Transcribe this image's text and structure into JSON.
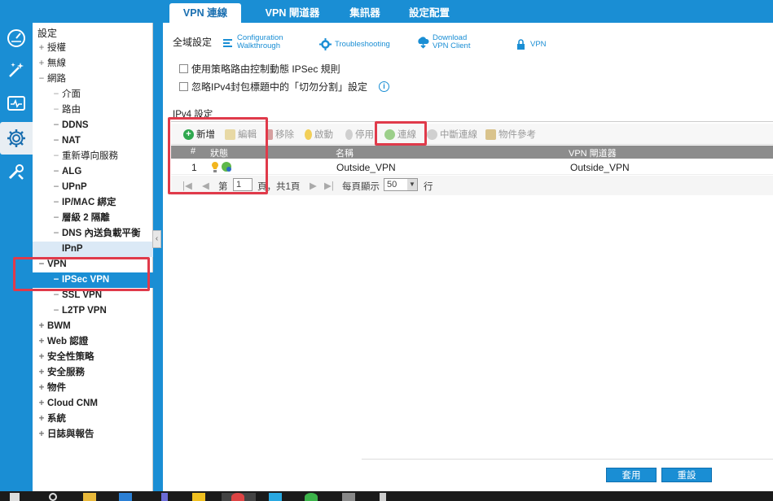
{
  "rail": {
    "items": [
      {
        "icon": "dashboard-icon"
      },
      {
        "icon": "wizard-icon"
      },
      {
        "icon": "monitor-icon"
      },
      {
        "icon": "gear-icon"
      },
      {
        "icon": "maintenance-icon"
      }
    ]
  },
  "tabs": [
    "VPN 連線",
    "VPN 閘道器",
    "集訊器",
    "設定配置"
  ],
  "nav": {
    "title": "設定",
    "items": [
      {
        "label": "授權",
        "pm": "+"
      },
      {
        "label": "無線",
        "pm": "+"
      },
      {
        "label": "網路",
        "pm": "−"
      },
      {
        "label": "介面",
        "pm": "−"
      },
      {
        "label": "路由",
        "pm": "−"
      },
      {
        "label": "DDNS",
        "pm": "−"
      },
      {
        "label": "NAT",
        "pm": "−"
      },
      {
        "label": "重新導向服務",
        "pm": "−"
      },
      {
        "label": "ALG",
        "pm": "−"
      },
      {
        "label": "UPnP",
        "pm": "−"
      },
      {
        "label": "IP/MAC 綁定",
        "pm": "−"
      },
      {
        "label": "層級 2 隔離",
        "pm": "−"
      },
      {
        "label": "DNS 內送負載平衡",
        "pm": "−"
      },
      {
        "label": "IPnP",
        "pm": ""
      },
      {
        "label": "VPN",
        "pm": "−"
      },
      {
        "label": "IPSec VPN",
        "pm": "−"
      },
      {
        "label": "SSL VPN",
        "pm": "−"
      },
      {
        "label": "L2TP VPN",
        "pm": "−"
      },
      {
        "label": "BWM",
        "pm": "+"
      },
      {
        "label": "Web 認證",
        "pm": "+"
      },
      {
        "label": "安全性策略",
        "pm": "+"
      },
      {
        "label": "安全服務",
        "pm": "+"
      },
      {
        "label": "物件",
        "pm": "+"
      },
      {
        "label": "Cloud CNM",
        "pm": "+"
      },
      {
        "label": "系統",
        "pm": "+"
      },
      {
        "label": "日誌與報告",
        "pm": "+"
      }
    ]
  },
  "main": {
    "global_label": "全域設定",
    "top_buttons": [
      {
        "label1": "Configuration",
        "label2": "Walkthrough",
        "icon": "walkthrough-icon"
      },
      {
        "label1": "Troubleshooting",
        "label2": "",
        "icon": "troubleshooting-icon"
      },
      {
        "label1": "Download",
        "label2": "VPN Client",
        "icon": "download-icon"
      },
      {
        "label1": "VPN",
        "label2": "",
        "icon": "vpn-lock-icon"
      }
    ],
    "checkbox1": "使用策略路由控制動態 IPSec 規則",
    "checkbox2": "忽略IPv4封包標題中的「切勿分割」設定",
    "section_title": "IPv4 設定",
    "grid_tools": [
      "新增",
      "編輯",
      "移除",
      "啟動",
      "停用",
      "連線",
      "中斷連線",
      "物件參考"
    ],
    "columns": [
      "#",
      "狀態",
      "名稱",
      "VPN 閘道器"
    ],
    "rows": [
      {
        "num": "1",
        "name": "Outside_VPN",
        "gateway": "Outside_VPN"
      }
    ],
    "pager": {
      "page_prefix": "第",
      "page": "1",
      "page_suffix": "頁，共1頁",
      "per_page_label": "每頁顯示",
      "per_page": "50",
      "per_page_suffix": "行"
    },
    "apply": "套用",
    "reset": "重設"
  }
}
